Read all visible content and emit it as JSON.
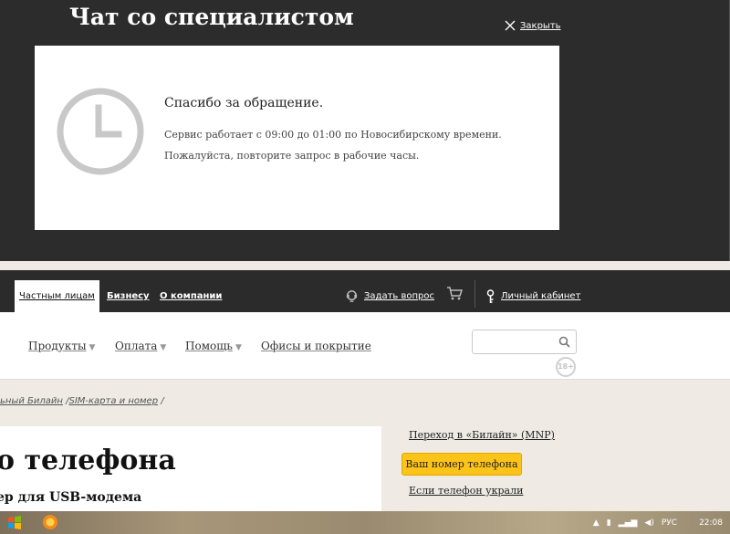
{
  "chat": {
    "title": "Чат со специалистом",
    "close_label": "Закрыть",
    "thanks": "Спасибо за обращение.",
    "hours": "Сервис работает с 09:00 до 01:00 по Новосибирскому времени.",
    "retry": "Пожалуйста, повторите запрос в рабочие часы."
  },
  "topnav": {
    "private": "Частным лицам",
    "business": "Бизнесу",
    "about": "О компании",
    "ask": "Задать вопрос",
    "cabinet": "Личный кабинет"
  },
  "menu": {
    "products": "Продукты",
    "payment": "Оплата",
    "help": "Помощь",
    "offices": "Офисы и покрытие",
    "age_badge": "18+"
  },
  "breadcrumbs": {
    "item1": "ьный Билайн",
    "item2": "SIM-карта и номер"
  },
  "content": {
    "heading": "о телефона",
    "subheading": "ер для USB-модема"
  },
  "sidebar": {
    "mnp": "Переход в «Билайн» (MNP)",
    "your_number": "Ваш номер телефона",
    "stolen": "Если телефон украли"
  },
  "taskbar": {
    "lang": "РУС",
    "time": "22:08"
  },
  "colors": {
    "overlay_bg": "#2c2c2c",
    "accent_yellow": "#fcc318"
  }
}
